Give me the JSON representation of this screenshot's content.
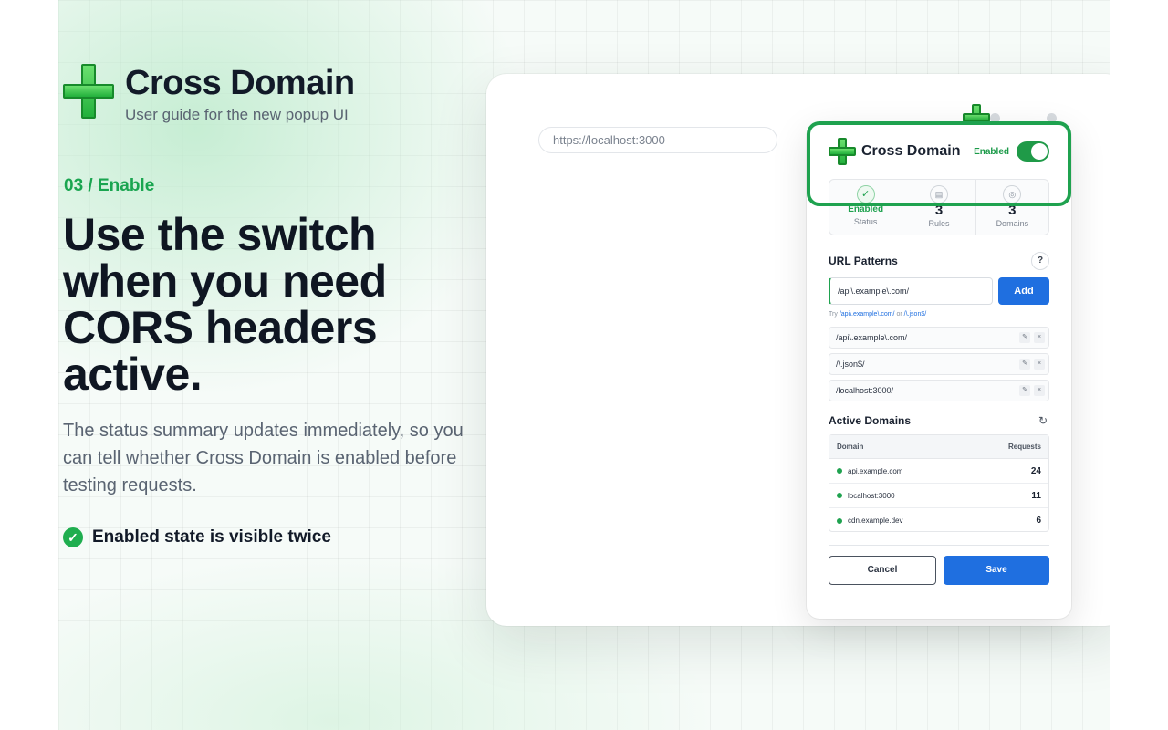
{
  "hero": {
    "brand_title": "Cross Domain",
    "brand_subtitle": "User guide for the new popup UI",
    "step_label": "03 / Enable",
    "headline": "Use the switch when you need CORS headers active.",
    "description": "The status summary updates immediately, so you can tell whether Cross Domain is enabled before testing requests.",
    "check_text": "Enabled state is visible twice",
    "accent_color": "#1aa550"
  },
  "browser": {
    "url": "https://localhost:3000"
  },
  "popup": {
    "title": "Cross Domain",
    "status_label": "Enabled",
    "toggle_on": true,
    "stats": [
      {
        "icon": "check-icon",
        "value": "Enabled",
        "label": "Status"
      },
      {
        "icon": "list-icon",
        "value": "3",
        "label": "Rules"
      },
      {
        "icon": "globe-icon",
        "value": "3",
        "label": "Domains"
      }
    ],
    "url_patterns": {
      "title": "URL Patterns",
      "help": "?",
      "input_value": "/api\\.example\\.com/",
      "add_label": "Add",
      "hint_prefix": "Try",
      "hint_example_1": "/api\\.example\\.com/",
      "hint_or": "or",
      "hint_example_2": "/\\.json$/",
      "rules": [
        {
          "pattern": "/api\\.example\\.com/"
        },
        {
          "pattern": "/\\.json$/"
        },
        {
          "pattern": "/localhost:3000/"
        }
      ],
      "edit_glyph": "✎",
      "delete_glyph": "×"
    },
    "active_domains": {
      "title": "Active Domains",
      "col_domain": "Domain",
      "col_requests": "Requests",
      "rows": [
        {
          "domain": "api.example.com",
          "requests": "24"
        },
        {
          "domain": "localhost:3000",
          "requests": "11"
        },
        {
          "domain": "cdn.example.dev",
          "requests": "6"
        }
      ]
    },
    "cancel_label": "Cancel",
    "save_label": "Save",
    "primary_color": "#1f6fe0",
    "success_color": "#1fa24f"
  }
}
